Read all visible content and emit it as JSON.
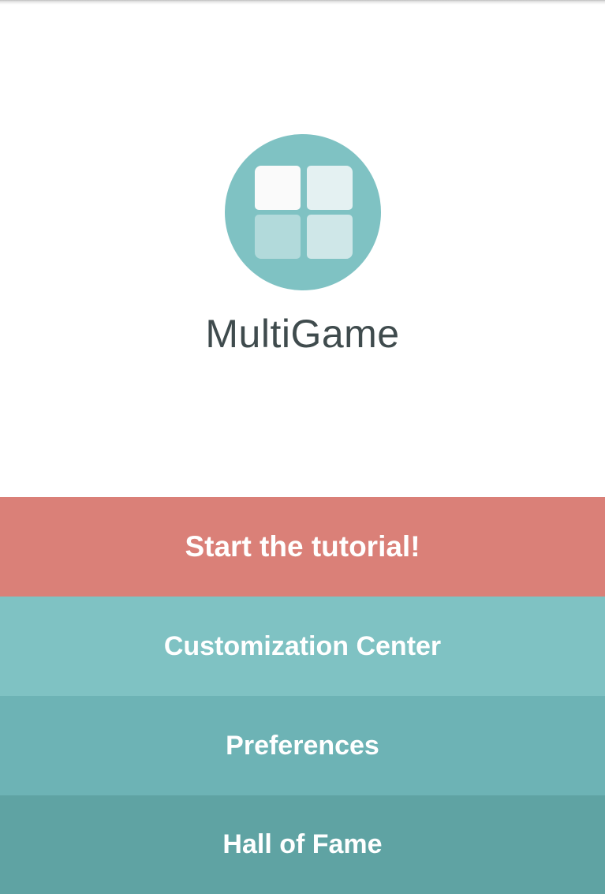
{
  "app": {
    "title": "MultiGame",
    "logo_icon": "four-square-grid-icon"
  },
  "colors": {
    "logo_circle": "#7fc2c3",
    "tile_top_left": "#fafafa",
    "tile_top_right": "#e4f1f2",
    "tile_bottom_left": "#b2dadb",
    "tile_bottom_right": "#cfe7e8",
    "title_text": "#3f4b4d",
    "tutorial_bg": "#da8078",
    "customization_bg": "#7fc2c3",
    "preferences_bg": "#6db3b5",
    "hall_of_fame_bg": "#5fa3a3",
    "button_text": "#ffffff"
  },
  "menu": {
    "tutorial_label": "Start the tutorial!",
    "customization_label": "Customization Center",
    "preferences_label": "Preferences",
    "hall_of_fame_label": "Hall of Fame"
  }
}
